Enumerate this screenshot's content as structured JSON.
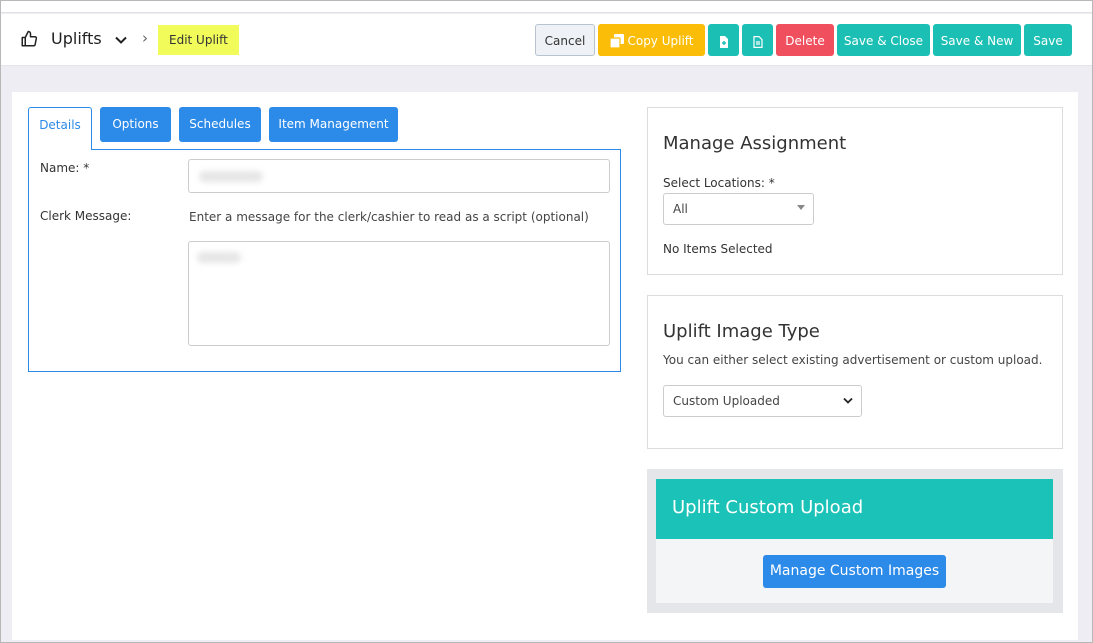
{
  "header": {
    "title": "Uplifts",
    "separator": "›",
    "current": "Edit Uplift",
    "buttons": {
      "cancel": "Cancel",
      "copy": "Copy Uplift",
      "delete": "Delete",
      "save_close": "Save & Close",
      "save_new": "Save & New",
      "save": "Save"
    }
  },
  "tabs": [
    {
      "label": "Details",
      "active": true
    },
    {
      "label": "Options",
      "active": false
    },
    {
      "label": "Schedules",
      "active": false
    },
    {
      "label": "Item Management",
      "active": false
    }
  ],
  "details": {
    "name_label": "Name: *",
    "clerk_label": "Clerk Message:",
    "clerk_help": "Enter a message for the clerk/cashier to read as a script (optional)"
  },
  "assignment": {
    "title": "Manage Assignment",
    "locations_label": "Select Locations: *",
    "locations_value": "All",
    "empty_text": "No Items Selected"
  },
  "image_type": {
    "title": "Uplift Image Type",
    "help": "You can either select existing advertisement or custom upload.",
    "selected": "Custom Uploaded"
  },
  "custom_upload": {
    "title": "Uplift Custom Upload",
    "button": "Manage Custom Images"
  },
  "colors": {
    "primary": "#2c8ae8",
    "teal": "#1bbfb4",
    "warning": "#fbbd08",
    "danger": "#f04f5e",
    "highlight": "#f1fb5a"
  }
}
